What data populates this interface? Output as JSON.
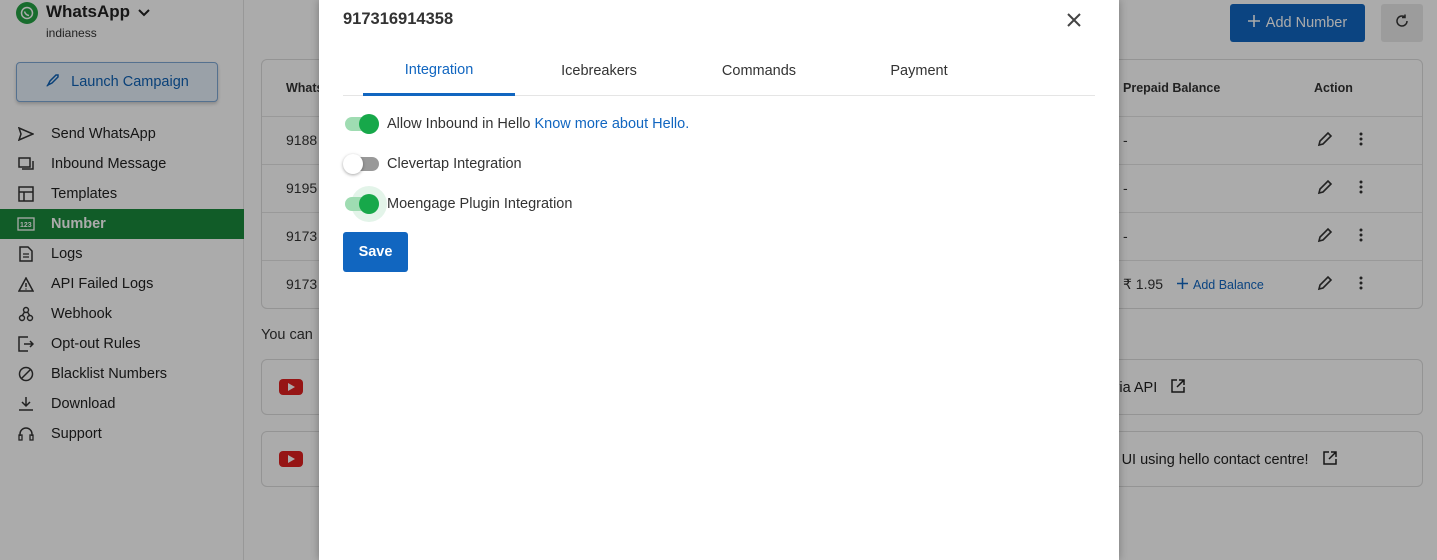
{
  "sidebar": {
    "brand_title": "WhatsApp",
    "brand_sub": "indianess",
    "launch_label": "Launch Campaign",
    "items": [
      {
        "label": "Send WhatsApp",
        "icon": "send-icon"
      },
      {
        "label": "Inbound Message",
        "icon": "inbox-icon"
      },
      {
        "label": "Templates",
        "icon": "template-icon"
      },
      {
        "label": "Number",
        "icon": "number-icon",
        "active": true
      },
      {
        "label": "Logs",
        "icon": "document-icon"
      },
      {
        "label": "API Failed Logs",
        "icon": "warning-icon"
      },
      {
        "label": "Webhook",
        "icon": "webhook-icon"
      },
      {
        "label": "Opt-out Rules",
        "icon": "exit-icon"
      },
      {
        "label": "Blacklist Numbers",
        "icon": "block-icon"
      },
      {
        "label": "Download",
        "icon": "download-icon"
      },
      {
        "label": "Support",
        "icon": "headset-icon"
      }
    ]
  },
  "header": {
    "add_number_label": "Add Number"
  },
  "table": {
    "columns": [
      "Whats",
      "Prepaid Balance",
      "Action"
    ],
    "rows": [
      {
        "number": "9188",
        "balance": "-"
      },
      {
        "number": "9195",
        "balance": "-"
      },
      {
        "number": "9173",
        "balance": "-"
      },
      {
        "number": "9173",
        "balance": "₹ 1.95",
        "add_balance": "Add Balance"
      }
    ]
  },
  "help": {
    "intro": "You can",
    "cards": [
      {
        "text": "e via API"
      },
      {
        "text": "via UI using hello contact centre!"
      }
    ]
  },
  "modal": {
    "title": "917316914358",
    "tabs": [
      "Integration",
      "Icebreakers",
      "Commands",
      "Payment"
    ],
    "active_tab": "Integration",
    "toggles": [
      {
        "label": "Allow Inbound in Hello",
        "link": "Know more about Hello.",
        "on": true
      },
      {
        "label": "Clevertap Integration",
        "on": false
      },
      {
        "label": "Moengage Plugin Integration",
        "on": true
      }
    ],
    "save_label": "Save"
  },
  "colors": {
    "primary": "#1166c0",
    "active_nav": "#1a8a3c",
    "toggle_on": "#17a84a"
  }
}
